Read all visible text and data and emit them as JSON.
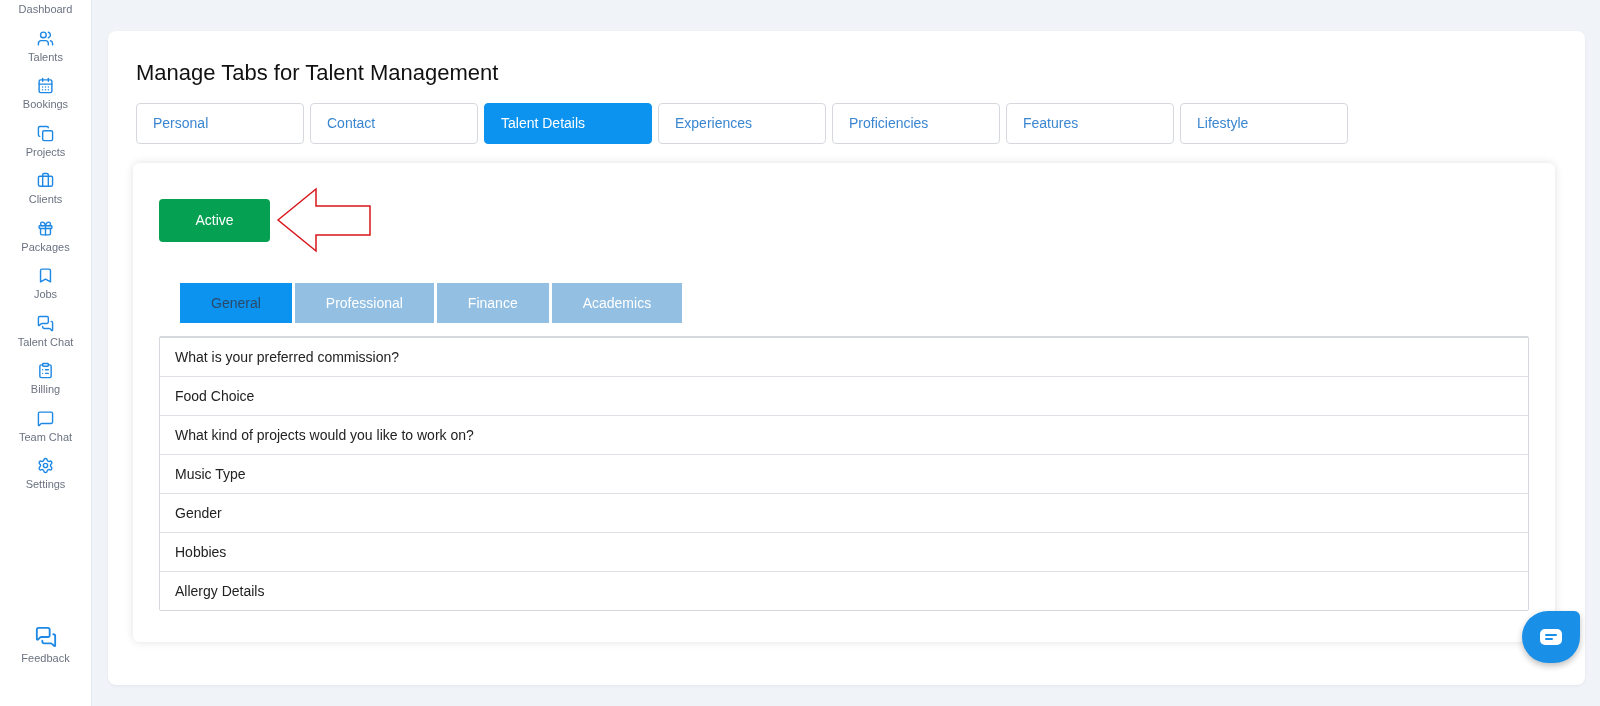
{
  "sidebar": {
    "items": [
      {
        "label": "Dashboard"
      },
      {
        "label": "Talents"
      },
      {
        "label": "Bookings"
      },
      {
        "label": "Projects"
      },
      {
        "label": "Clients"
      },
      {
        "label": "Packages"
      },
      {
        "label": "Jobs"
      },
      {
        "label": "Talent Chat"
      },
      {
        "label": "Billing"
      },
      {
        "label": "Team Chat"
      },
      {
        "label": "Settings"
      }
    ],
    "footer": {
      "label": "Feedback"
    }
  },
  "page": {
    "title": "Manage Tabs for Talent Management"
  },
  "tabs": [
    {
      "label": "Personal",
      "selected": false
    },
    {
      "label": "Contact",
      "selected": false
    },
    {
      "label": "Talent Details",
      "selected": true
    },
    {
      "label": "Experiences",
      "selected": false
    },
    {
      "label": "Proficiencies",
      "selected": false
    },
    {
      "label": "Features",
      "selected": false
    },
    {
      "label": "Lifestyle",
      "selected": false
    }
  ],
  "status_button": {
    "label": "Active"
  },
  "sub_tabs": [
    {
      "label": "General",
      "selected": true
    },
    {
      "label": "Professional",
      "selected": false
    },
    {
      "label": "Finance",
      "selected": false
    },
    {
      "label": "Academics",
      "selected": false
    }
  ],
  "questions": [
    "What is your preferred commission?",
    "Food Choice",
    "What kind of projects would you like to work on?",
    "Music Type",
    "Gender",
    "Hobbies",
    "Allergy Details"
  ]
}
